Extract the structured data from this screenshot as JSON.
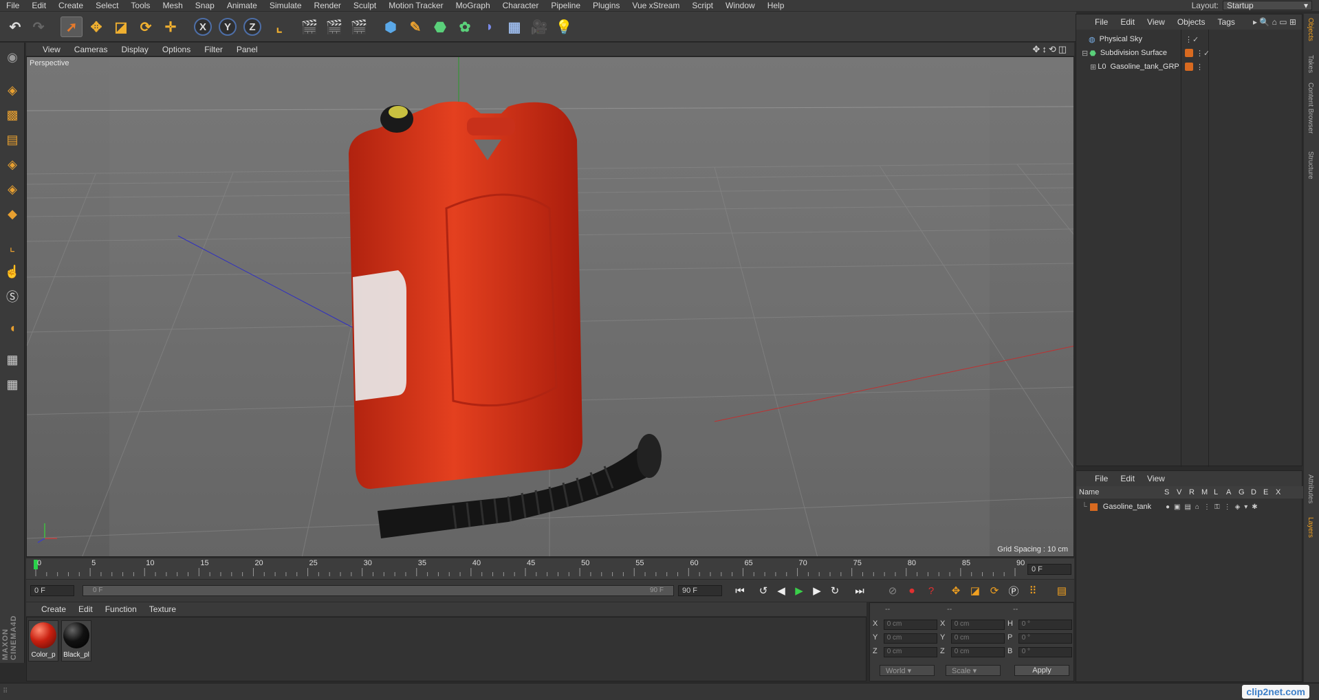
{
  "menubar": {
    "items": [
      "File",
      "Edit",
      "Create",
      "Select",
      "Tools",
      "Mesh",
      "Snap",
      "Animate",
      "Simulate",
      "Render",
      "Sculpt",
      "Motion Tracker",
      "MoGraph",
      "Character",
      "Pipeline",
      "Plugins",
      "Vue xStream",
      "Script",
      "Window",
      "Help"
    ],
    "layout_label": "Layout:",
    "layout_value": "Startup"
  },
  "toolbar": {
    "axis_x": "X",
    "axis_y": "Y",
    "axis_z": "Z"
  },
  "viewport": {
    "menu": [
      "View",
      "Cameras",
      "Display",
      "Options",
      "Filter",
      "Panel"
    ],
    "camera_label": "Perspective",
    "grid_spacing": "Grid Spacing : 10 cm"
  },
  "timeline": {
    "ticks": [
      "0",
      "5",
      "10",
      "15",
      "20",
      "25",
      "30",
      "35",
      "40",
      "45",
      "50",
      "55",
      "60",
      "65",
      "70",
      "75",
      "80",
      "85",
      "90"
    ],
    "current_frame": "0 F",
    "start_field": "0 F",
    "range_start": "0 F",
    "range_end": "90 F",
    "end_field": "90 F",
    "current": 0,
    "max": 90
  },
  "materials": {
    "menu": [
      "Create",
      "Edit",
      "Function",
      "Texture"
    ],
    "items": [
      {
        "label": "Color_p",
        "color": "#c82010"
      },
      {
        "label": "Black_pl",
        "color": "#111111"
      }
    ]
  },
  "coordinates": {
    "headers": [
      "--",
      "--",
      "--"
    ],
    "rows": [
      {
        "l1": "X",
        "v1": "0 cm",
        "l2": "X",
        "v2": "0 cm",
        "l3": "H",
        "v3": "0 °"
      },
      {
        "l1": "Y",
        "v1": "0 cm",
        "l2": "Y",
        "v2": "0 cm",
        "l3": "P",
        "v3": "0 °"
      },
      {
        "l1": "Z",
        "v1": "0 cm",
        "l2": "Z",
        "v2": "0 cm",
        "l3": "B",
        "v3": "0 °"
      }
    ],
    "mode": "World",
    "mode2": "Scale",
    "apply": "Apply"
  },
  "object_manager": {
    "menu": [
      "File",
      "Edit",
      "View",
      "Objects",
      "Tags"
    ],
    "objects": [
      {
        "name": "Physical Sky",
        "indent": 0
      },
      {
        "name": "Subdivision Surface",
        "indent": 0
      },
      {
        "name": "Gasoline_tank_GRP",
        "indent": 1
      }
    ]
  },
  "layer_manager": {
    "menu": [
      "File",
      "Edit",
      "View"
    ],
    "columns": [
      "Name",
      "S",
      "V",
      "R",
      "M",
      "L",
      "A",
      "G",
      "D",
      "E",
      "X"
    ],
    "layers": [
      {
        "name": "Gasoline_tank",
        "color": "#d86a20"
      }
    ]
  },
  "side_tabs": [
    "Objects",
    "Takes",
    "Content Browser",
    "Structure"
  ],
  "side_tabs_lower": [
    "Attributes",
    "Layers"
  ],
  "watermark": "clip2net.com",
  "colors": {
    "accent": "#f0a020",
    "tank": "#d8321c",
    "hose": "#151515"
  }
}
